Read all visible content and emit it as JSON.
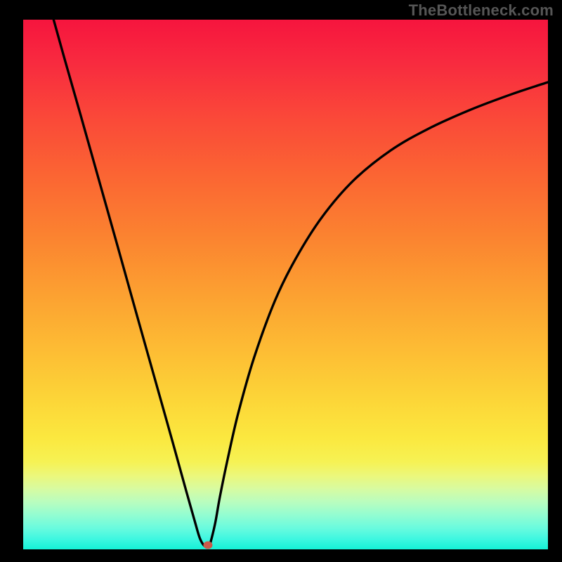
{
  "watermark": "TheBottleneck.com",
  "chart_data": {
    "type": "line",
    "title": "",
    "xlabel": "",
    "ylabel": "",
    "x_range": [
      0,
      1
    ],
    "y_range": [
      0,
      1
    ],
    "grid": false,
    "legend": false,
    "series": [
      {
        "name": "curve",
        "x": [
          0.058,
          0.08,
          0.11,
          0.145,
          0.18,
          0.215,
          0.25,
          0.285,
          0.311,
          0.327,
          0.337,
          0.346,
          0.354,
          0.357,
          0.366,
          0.375,
          0.39,
          0.41,
          0.44,
          0.48,
          0.52,
          0.57,
          0.63,
          0.7,
          0.77,
          0.85,
          0.93,
          1.0
        ],
        "y": [
          1.0,
          0.922,
          0.818,
          0.695,
          0.572,
          0.448,
          0.325,
          0.202,
          0.109,
          0.053,
          0.02,
          0.006,
          0.006,
          0.013,
          0.05,
          0.1,
          0.172,
          0.258,
          0.362,
          0.47,
          0.55,
          0.628,
          0.697,
          0.753,
          0.793,
          0.829,
          0.859,
          0.882
        ]
      }
    ],
    "markers": [
      {
        "name": "red-dot",
        "x": 0.352,
        "y": 0.008
      }
    ],
    "background_gradient": {
      "top": "#f6153e",
      "bottom": "#14f1d6"
    }
  }
}
